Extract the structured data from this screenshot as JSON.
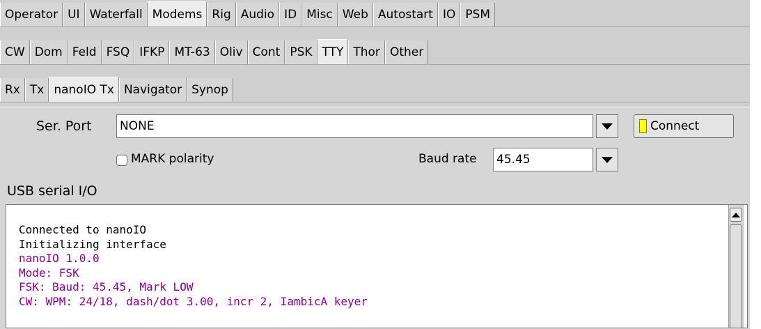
{
  "tabs_row1": [
    "Operator",
    "UI",
    "Waterfall",
    "Modems",
    "Rig",
    "Audio",
    "ID",
    "Misc",
    "Web",
    "Autostart",
    "IO",
    "PSM"
  ],
  "tabs_row1_active": "Modems",
  "tabs_row2": [
    "CW",
    "Dom",
    "Feld",
    "FSQ",
    "IFKP",
    "MT-63",
    "Oliv",
    "Cont",
    "PSK",
    "TTY",
    "Thor",
    "Other"
  ],
  "tabs_row2_active": "TTY",
  "tabs_row3": [
    "Rx",
    "Tx",
    "nanoIO Tx",
    "Navigator",
    "Synop"
  ],
  "tabs_row3_active": "nanoIO Tx",
  "serial": {
    "label": "Ser. Port",
    "value": "NONE"
  },
  "connect_button": {
    "label": "Connect",
    "led_color": "#ffff00"
  },
  "mark_polarity": {
    "label": "MARK polarity",
    "checked": false
  },
  "baud": {
    "label": "Baud rate",
    "value": "45.45"
  },
  "io_section": {
    "title": "USB serial I/O",
    "lines": [
      {
        "text": "Connected to nanoIO",
        "color": "#000000"
      },
      {
        "text": "Initializing interface",
        "color": "#000000"
      },
      {
        "text": "nanoIO 1.0.0",
        "color": "#8b008b"
      },
      {
        "text": "Mode: FSK",
        "color": "#8b008b"
      },
      {
        "text": "FSK: Baud: 45.45, Mark LOW",
        "color": "#8b008b"
      },
      {
        "text": "CW: WPM: 24/18, dash/dot 3.00, incr 2, IambicA keyer",
        "color": "#8b008b"
      }
    ]
  }
}
